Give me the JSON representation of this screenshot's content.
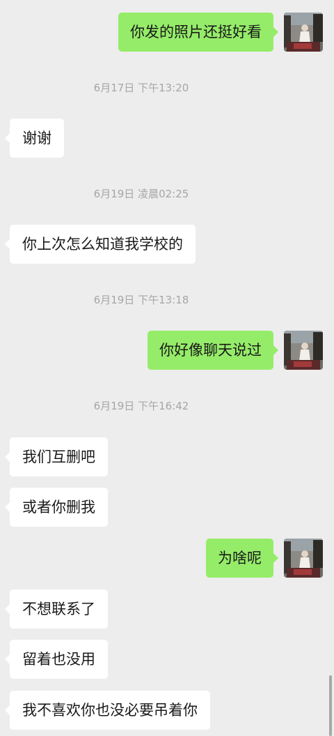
{
  "messages": [
    {
      "type": "sent",
      "text": "你发的照片还挺好看"
    },
    {
      "type": "time",
      "text": "6月17日 下午13:20"
    },
    {
      "type": "received",
      "text": "谢谢"
    },
    {
      "type": "time",
      "text": "6月19日 凌晨02:25"
    },
    {
      "type": "received",
      "text": "你上次怎么知道我学校的"
    },
    {
      "type": "time",
      "text": "6月19日 下午13:18"
    },
    {
      "type": "sent",
      "text": "你好像聊天说过"
    },
    {
      "type": "time",
      "text": "6月19日 下午16:42"
    },
    {
      "type": "received",
      "text": "我们互删吧"
    },
    {
      "type": "received",
      "text": "或者你删我"
    },
    {
      "type": "sent",
      "text": "为啥呢"
    },
    {
      "type": "received",
      "text": "不想联系了"
    },
    {
      "type": "received",
      "text": "留着也没用"
    },
    {
      "type": "received",
      "text": "我不喜欢你也没必要吊着你"
    }
  ],
  "colors": {
    "background": "#ededed",
    "sent_bubble": "#95ec69",
    "received_bubble": "#ffffff",
    "timestamp": "#a6a6a6"
  }
}
